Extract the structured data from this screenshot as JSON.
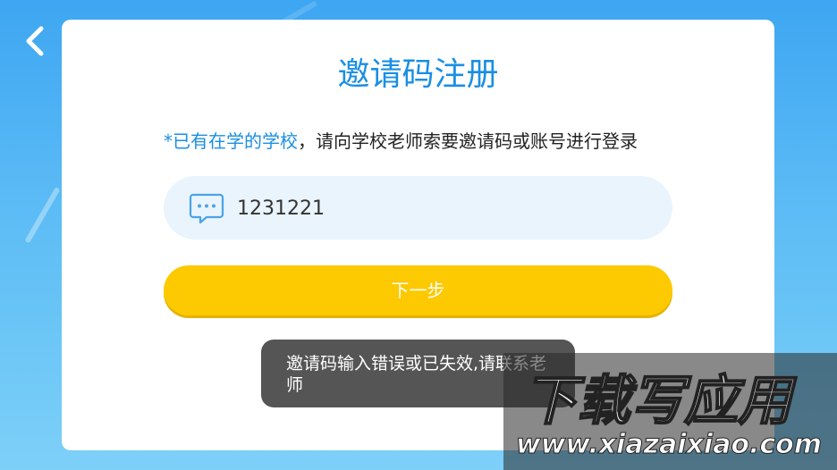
{
  "header": {
    "back_icon": "chevron-left-icon"
  },
  "card": {
    "title": "邀请码注册",
    "notice_highlight": "*已有在学的学校",
    "notice_rest": "，请向学校老师索要邀请码或账号进行登录",
    "code_input": {
      "icon": "message-bubble-icon",
      "value": "1231221"
    },
    "next_label": "下一步"
  },
  "toast": {
    "text": "邀请码输入错误或已失效,请联系老师"
  },
  "watermark": {
    "line1": "下载写应用",
    "line2": "www.xiazaixiao.com"
  },
  "colors": {
    "background_top": "#3ea6f2",
    "accent_blue": "#1a8fe3",
    "button_yellow": "#fdc900",
    "input_bg": "#eaf4fc",
    "toast_bg": "#464646"
  }
}
